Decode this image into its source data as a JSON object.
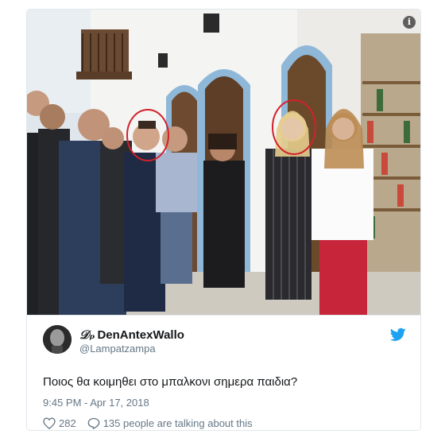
{
  "tweet": {
    "display_name": "DenAntexWallo",
    "name_prefix": "𝒟ₚ",
    "handle": "@Lampatzampa",
    "text": "Ποιος θα κοιμηθει στο μπαλκονι σημερα παιδια?",
    "timestamp": "9:45 PM - Apr 17, 2018",
    "likes": "282",
    "replies_label": "135 people are talking about this"
  },
  "media": {
    "info_glyph": "i"
  },
  "colors": {
    "brand": "#1da1f2",
    "text": "#14171a",
    "muted": "#657786",
    "border": "#e1e8ed"
  },
  "icons": [
    "info-icon",
    "twitter-bird-icon",
    "heart-icon",
    "speech-bubble-icon"
  ]
}
